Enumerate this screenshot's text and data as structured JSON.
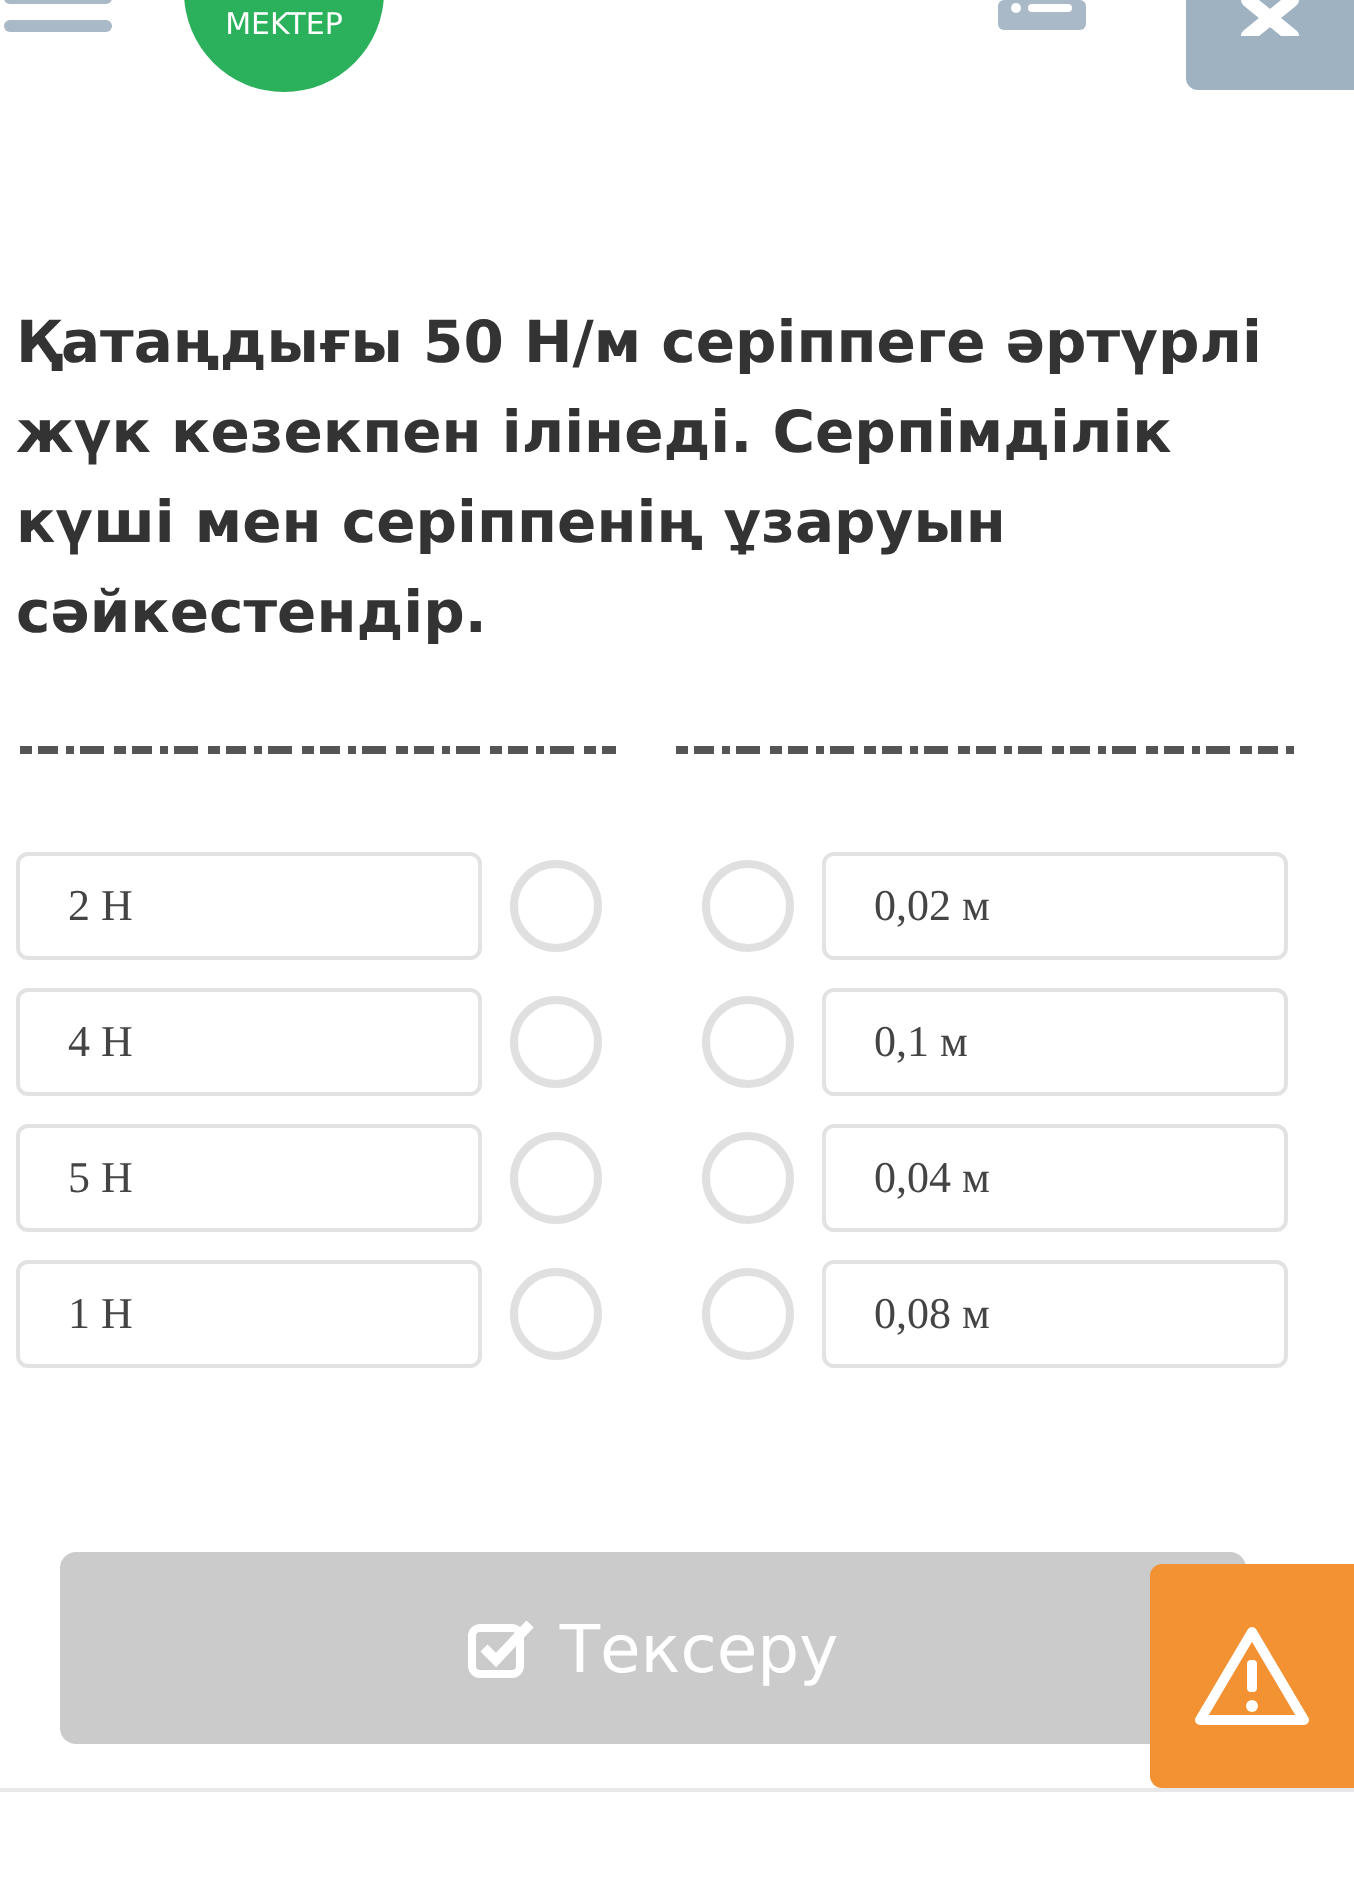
{
  "header": {
    "logo": "MEKTEP"
  },
  "question": "Қатаңдығы 50 Н/м серіппеге әртүрлі жүк кезекпен ілінеді. Серпімділік күші мен серіппенің ұзаруын сәйкестендір.",
  "left": [
    "2 Н",
    "4 Н",
    "5 Н",
    "1 Н"
  ],
  "right": [
    "0,02 м",
    "0,1 м",
    "0,04 м",
    "0,08 м"
  ],
  "check_button": {
    "label": "Тексеру",
    "disabled": true
  }
}
